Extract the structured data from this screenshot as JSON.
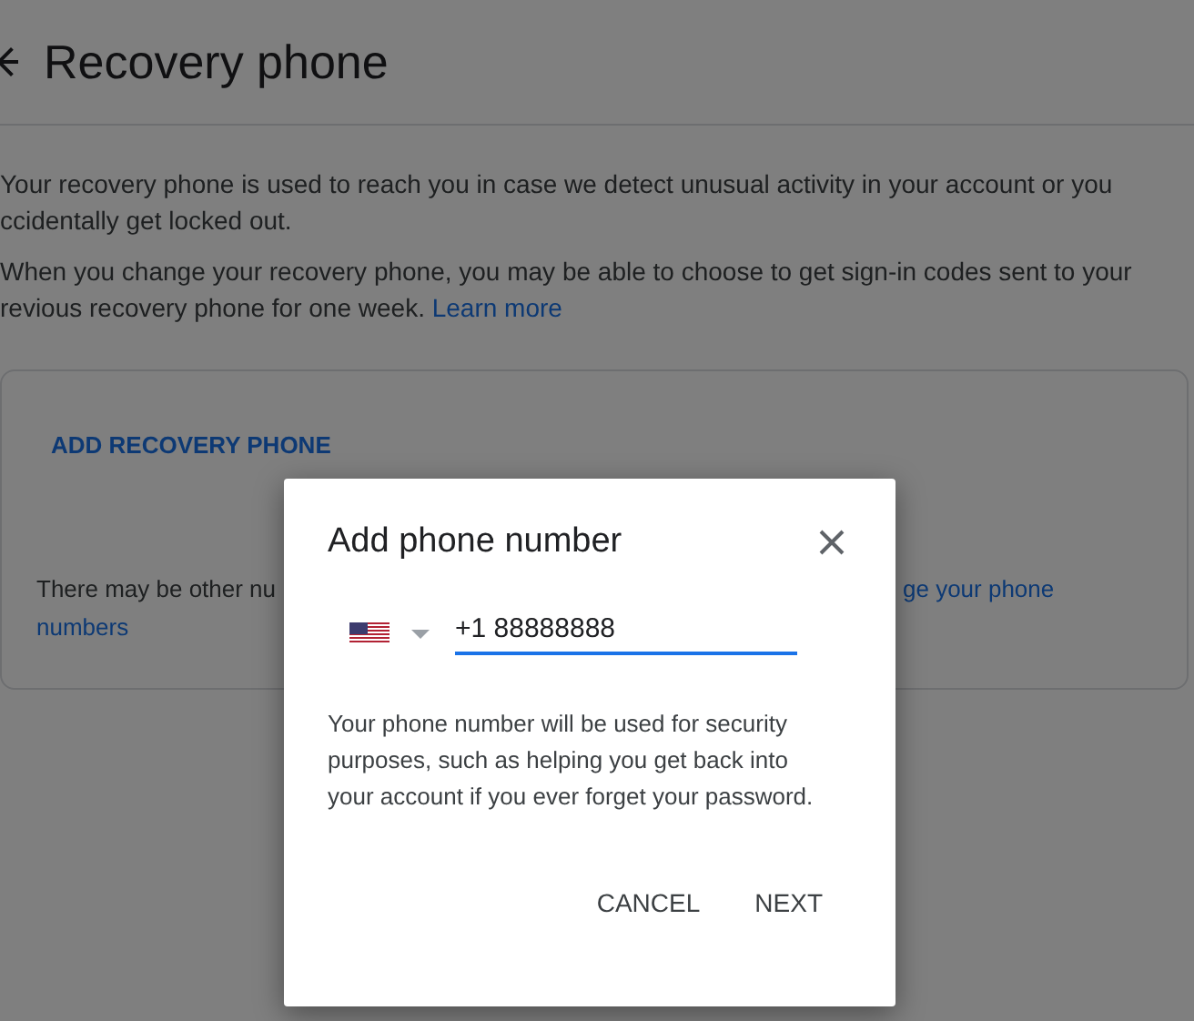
{
  "page": {
    "title": "Recovery phone",
    "description_lines": [
      "Your recovery phone is used to reach you in case we detect unusual activity in your account or you",
      "ccidentally get locked out."
    ],
    "note_lines": [
      "When you change your recovery phone, you may be able to choose to get sign-in codes sent to your"
    ],
    "note_last_line": "revious recovery phone for one week.",
    "note_link": "Learn more",
    "card": {
      "action": "ADD RECOVERY PHONE",
      "text_left": "There may be other nu",
      "link_right": "ge your phone",
      "link_second_line": "numbers"
    }
  },
  "dialog": {
    "title": "Add phone number",
    "phone": {
      "value": "+1 88888888",
      "focused": true
    },
    "help": "Your phone number will be used for security purposes, such as helping you get back into your account if you ever forget your password.",
    "buttons": [
      "CANCEL",
      "NEXT"
    ]
  }
}
